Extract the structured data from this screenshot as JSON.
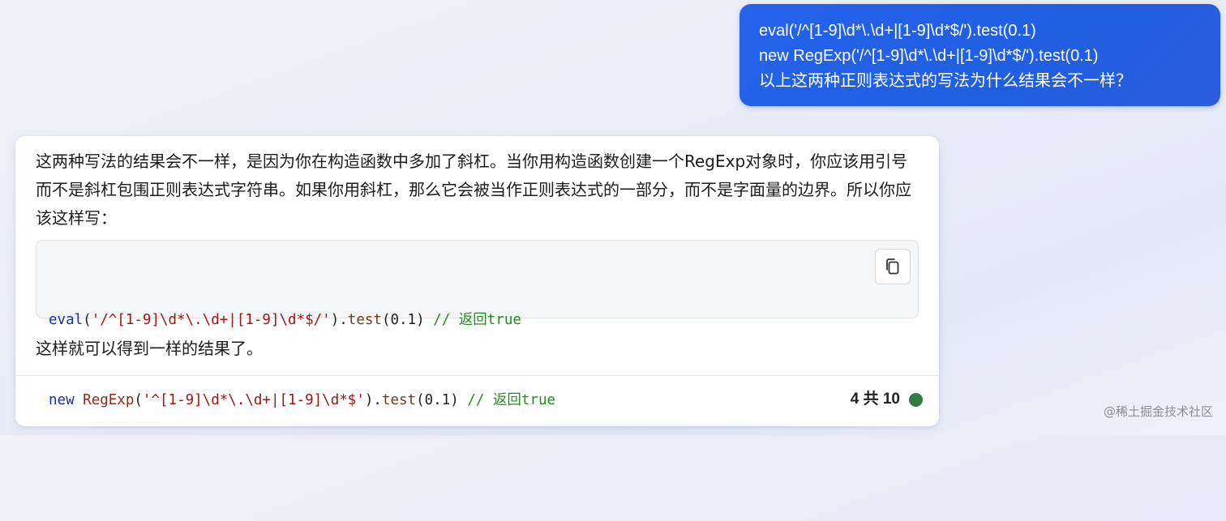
{
  "user_message": {
    "lines": [
      "eval('/^[1-9]\\d*\\.\\d+|[1-9]\\d*$/').test(0.1)",
      "new RegExp('/^[1-9]\\d*\\.\\d+|[1-9]\\d*$/').test(0.1)",
      "以上这两种正则表达式的写法为什么结果会不一样？"
    ]
  },
  "answer": {
    "paragraphs": [
      "这两种写法的结果会不一样，是因为你在构造函数中多加了斜杠。当你用构造函数创建一个RegExp对象时，你应该用引号而不是斜杠包围正则表达式字符串。如果你用斜杠，那么它会被当作正则表达式的一部分，而不是字面量的边界。所以你应该这样写：",
      "这样就可以得到一样的结果了。"
    ],
    "code": {
      "line1": {
        "kw": "eval",
        "open": "(",
        "str": "'/^[1-9]\\d*\\.\\d+|[1-9]\\d*$/'",
        "close": ").",
        "fn": "test",
        "args": "(0.1) ",
        "comment": "// 返回true"
      },
      "line2": {
        "kw": "new",
        "sp": " ",
        "cls": "RegExp",
        "open": "(",
        "str": "'^[1-9]\\d*\\.\\d+|[1-9]\\d*$'",
        "close": ").",
        "fn": "test",
        "args": "(0.1) ",
        "comment": "// 返回true"
      }
    },
    "copy_icon": "copy-icon"
  },
  "footer": {
    "count_text": "4 共 10",
    "status_color": "#2e7d46"
  },
  "watermark": "@稀土掘金技术社区",
  "colors": {
    "user_bubble": "#2563eb",
    "code_keyword": "#1e2aa8",
    "code_string": "#a31515",
    "code_comment": "#268a1e"
  }
}
